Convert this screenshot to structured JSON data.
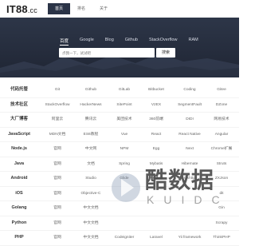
{
  "header": {
    "logo": "IT88",
    "logo_suffix": ".cc",
    "nav": [
      "首页",
      "排名",
      "关于"
    ]
  },
  "search": {
    "tabs": [
      "百度",
      "Google",
      "Blog",
      "Github",
      "StackOverflow",
      "RAM"
    ],
    "placeholder": "点我一下，试试吧",
    "button": "搜索"
  },
  "categories": [
    {
      "name": "代码托管",
      "links": [
        "Git",
        "Github",
        "GitLab",
        "Bitbucket",
        "Coding",
        "Gitee"
      ]
    },
    {
      "name": "技术社区",
      "links": [
        "StackOverflow",
        "HackerNews",
        "SitePoint",
        "V2EX",
        "SegmentFault",
        "DZone"
      ]
    },
    {
      "name": "大厂博客",
      "links": [
        "阿里云",
        "腾讯云",
        "美团技术",
        "360前端",
        "DIDI",
        "网易技术",
        "百度技术"
      ]
    },
    {
      "name": "JavaScript",
      "links": [
        "MDN文档",
        "ES6教程",
        "Vue",
        "React",
        "React Native",
        "Angular"
      ]
    },
    {
      "name": "Node.js",
      "links": [
        "官网",
        "中文网",
        "NPM",
        "Egg",
        "Next",
        "Chrome扩展"
      ]
    },
    {
      "name": "Java",
      "links": [
        "官网",
        "文档",
        "Spring",
        "Mybatis",
        "Hibernate",
        "Struts"
      ]
    },
    {
      "name": "Android",
      "links": [
        "官网",
        "Studio",
        "Glide",
        "Picasso",
        "Okhttp",
        "ZXJson"
      ]
    },
    {
      "name": "iOS",
      "links": [
        "官网",
        "Objective-C",
        "",
        "",
        "",
        "dit"
      ]
    },
    {
      "name": "Golang",
      "links": [
        "官网",
        "中文文档",
        "",
        "",
        "",
        "Gin"
      ]
    },
    {
      "name": "Python",
      "links": [
        "官网",
        "中文文档",
        "",
        "",
        "",
        "Scrapy"
      ]
    },
    {
      "name": "PHP",
      "links": [
        "官网",
        "中文文档",
        "Codeigniter",
        "Laravel",
        "Yii framework",
        "ThinkPHP"
      ]
    }
  ],
  "watermark": {
    "big": "酷数据",
    "small": "KUIDC"
  }
}
